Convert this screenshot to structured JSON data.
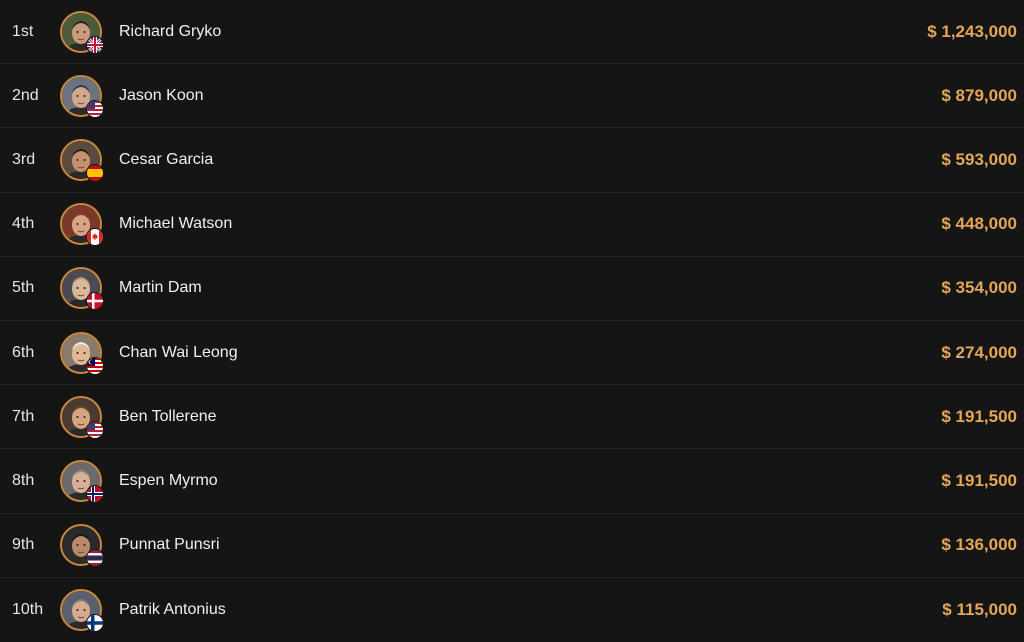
{
  "results": [
    {
      "place": "1st",
      "name": "Richard Gryko",
      "prize": "$ 1,243,000",
      "flag": "flag-uk-icon",
      "skin": "#c99a7c",
      "hair": "#2b211b",
      "bg": "#4a5a3a"
    },
    {
      "place": "2nd",
      "name": "Jason Koon",
      "prize": "$ 879,000",
      "flag": "flag-us-icon",
      "skin": "#d3a98d",
      "hair": "#2a3950",
      "bg": "#6b7380"
    },
    {
      "place": "3rd",
      "name": "Cesar Garcia",
      "prize": "$ 593,000",
      "flag": "flag-es-icon",
      "skin": "#c49070",
      "hair": "#2a1c14",
      "bg": "#5a4a40"
    },
    {
      "place": "4th",
      "name": "Michael Watson",
      "prize": "$ 448,000",
      "flag": "flag-ca-icon",
      "skin": "#d8a488",
      "hair": "#8a3b22",
      "bg": "#7a3a2a"
    },
    {
      "place": "5th",
      "name": "Martin Dam",
      "prize": "$ 354,000",
      "flag": "flag-dk-icon",
      "skin": "#dab79b",
      "hair": "#b89a6a",
      "bg": "#4a4a55"
    },
    {
      "place": "6th",
      "name": "Chan Wai Leong",
      "prize": "$ 274,000",
      "flag": "flag-my-icon",
      "skin": "#e0b898",
      "hair": "#f0f0f0",
      "bg": "#8a7a6a"
    },
    {
      "place": "7th",
      "name": "Ben Tollerene",
      "prize": "$ 191,500",
      "flag": "flag-us-icon",
      "skin": "#d6a57f",
      "hair": "#6b5030",
      "bg": "#4a3a30"
    },
    {
      "place": "8th",
      "name": "Espen Myrmo",
      "prize": "$ 191,500",
      "flag": "flag-no-icon",
      "skin": "#d8b09a",
      "hair": "#9a8a7a",
      "bg": "#6a6a6a"
    },
    {
      "place": "9th",
      "name": "Punnat Punsri",
      "prize": "$ 136,000",
      "flag": "flag-th-icon",
      "skin": "#b88a6a",
      "hair": "#151515",
      "bg": "#2a2a2a"
    },
    {
      "place": "10th",
      "name": "Patrik Antonius",
      "prize": "$ 115,000",
      "flag": "flag-fi-icon",
      "skin": "#d4aa90",
      "hair": "#7a7a7a",
      "bg": "#5a6070"
    }
  ],
  "colors": {
    "background": "#151515",
    "divider": "#262626",
    "prize": "#e2a65a",
    "ring": "#c8893a"
  }
}
